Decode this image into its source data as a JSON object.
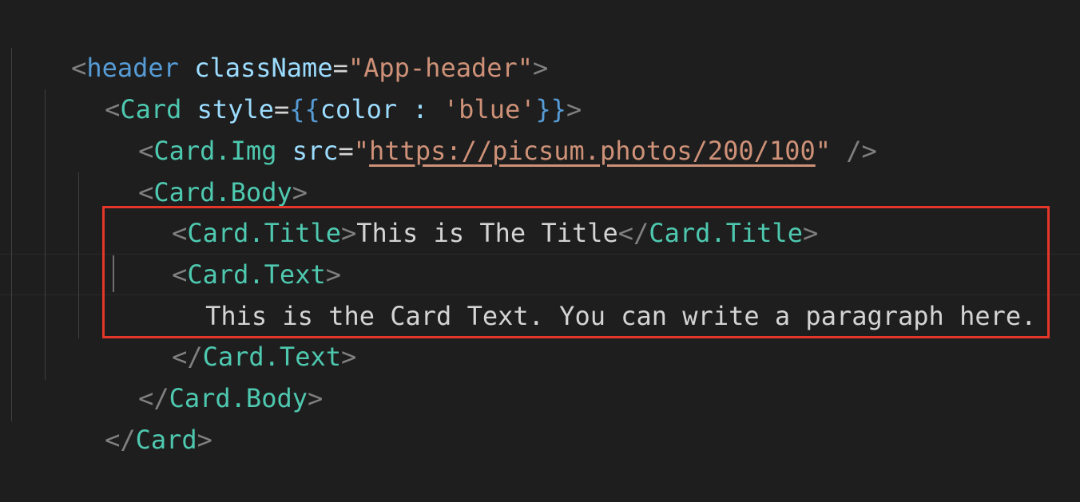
{
  "colors": {
    "background": "#1e1e1e",
    "punctuation": "#808080",
    "html_tag": "#569cd6",
    "component": "#4ec9b0",
    "attribute": "#9cdcfe",
    "string": "#ce9178",
    "text": "#d4d4d4",
    "highlight_border": "#e5362a"
  },
  "code": {
    "line1": {
      "open": "<",
      "tag": "header",
      "attr": " className",
      "eq": "=",
      "value": "\"App-header\"",
      "close": ">"
    },
    "line2": {
      "open": "<",
      "tag": "Card",
      "attr": " style",
      "eq": "=",
      "brace_open": "{{",
      "expr": "color : ",
      "value": "'blue'",
      "brace_close": "}}",
      "close": ">"
    },
    "line3": {
      "open": "<",
      "tag": "Card.Img",
      "attr": " src",
      "eq": "=",
      "quote_open": "\"",
      "url": "https://picsum.photos/200/100",
      "quote_close": "\"",
      "close": " />"
    },
    "line4": {
      "open": "<",
      "tag": "Card.Body",
      "close": ">"
    },
    "line5": {
      "open": "<",
      "tag": "Card.Title",
      "close": ">",
      "content": "This is The Title",
      "end_open": "</",
      "end_tag": "Card.Title",
      "end_close": ">"
    },
    "line6": {
      "open": "<",
      "tag": "Card.Text",
      "close": ">"
    },
    "line7": {
      "content": "This is the Card Text. You can write a paragraph here."
    },
    "line8": {
      "open": "</",
      "tag": "Card.Text",
      "close": ">"
    },
    "line9": {
      "open": "</",
      "tag": "Card.Body",
      "close": ">"
    },
    "line10": {
      "open": "</",
      "tag": "Card",
      "close": ">"
    }
  }
}
